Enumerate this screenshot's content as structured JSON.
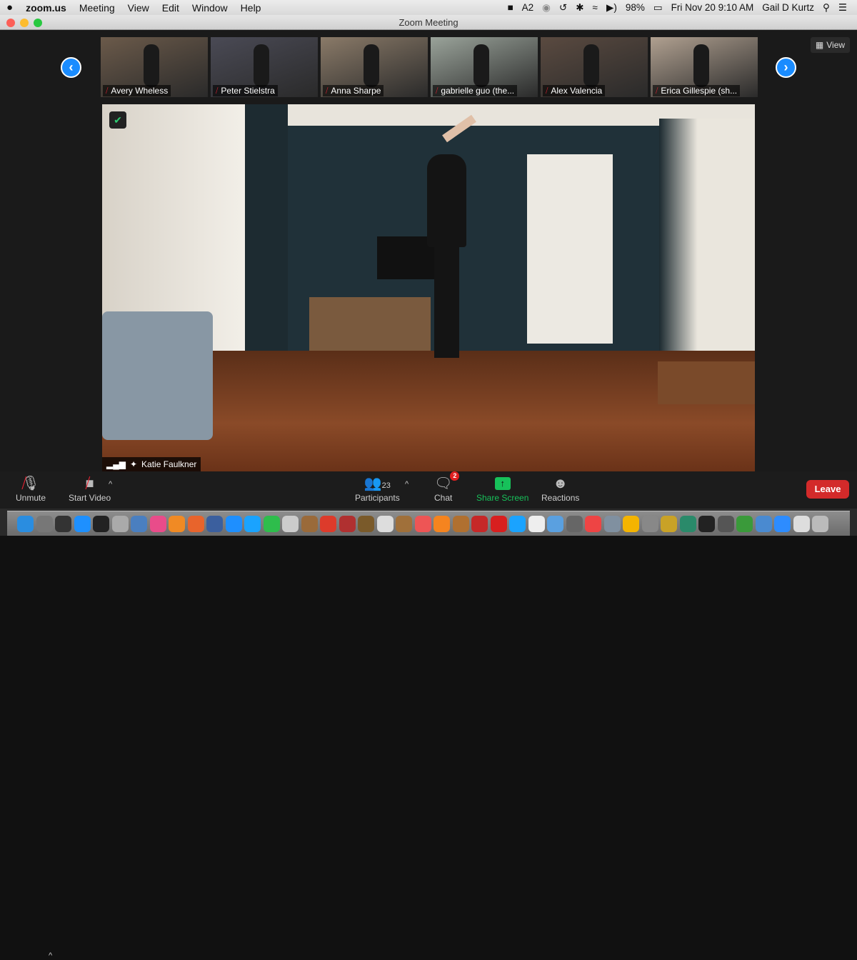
{
  "menubar": {
    "apple": "",
    "app": "zoom.us",
    "items": [
      "Meeting",
      "View",
      "Edit",
      "Window",
      "Help"
    ],
    "status": {
      "adobe_count": "2",
      "battery": "98%",
      "datetime": "Fri Nov 20  9:10 AM",
      "user": "Gail D Kurtz"
    }
  },
  "window": {
    "title": "Zoom Meeting"
  },
  "gallery": {
    "prev": "‹",
    "next": "›",
    "view_label": "View",
    "participants": [
      {
        "name": "Avery Wheless",
        "bg": "#6b5a4a"
      },
      {
        "name": "Peter Stielstra",
        "bg": "#4a4a55"
      },
      {
        "name": "Anna Sharpe",
        "bg": "#8a7a68"
      },
      {
        "name": "gabrielle guo (the...",
        "bg": "#9aa39a"
      },
      {
        "name": "Alex Valencia",
        "bg": "#5a4a40"
      },
      {
        "name": "Erica Gillespie (sh...",
        "bg": "#b0a090"
      }
    ]
  },
  "main_video": {
    "speaker": "Katie Faulkner"
  },
  "toolbar": {
    "unmute": "Unmute",
    "start_video": "Start Video",
    "participants": "Participants",
    "participant_count": "23",
    "chat": "Chat",
    "chat_badge": "2",
    "share": "Share Screen",
    "reactions": "Reactions",
    "leave": "Leave",
    "share_color": "#17c15a",
    "leave_color": "#d32a2a"
  },
  "dock": [
    "#2a8de0",
    "#777",
    "#333",
    "#1e90ff",
    "#222",
    "#aaa",
    "#4a7fc0",
    "#e94c8a",
    "#f08a24",
    "#e8642c",
    "#3b5f9e",
    "#1e8fff",
    "#1aa3ff",
    "#2ebd4c",
    "#ccc",
    "#9a6a3a",
    "#dd3b2b",
    "#b03030",
    "#7a5a2a",
    "#ddd",
    "#a0703a",
    "#e55",
    "#f5841f",
    "#b07030",
    "#c62828",
    "#d81f1f",
    "#1aa3ff",
    "#eee",
    "#5aa0e0",
    "#666",
    "#e44",
    "#8090a0",
    "#f4b400",
    "#888",
    "#c9a227",
    "#2a8a6a",
    "#222",
    "#555",
    "#3a9a3a",
    "#4a8ad0",
    "#2d8cff",
    "#ddd",
    "#bbb"
  ]
}
